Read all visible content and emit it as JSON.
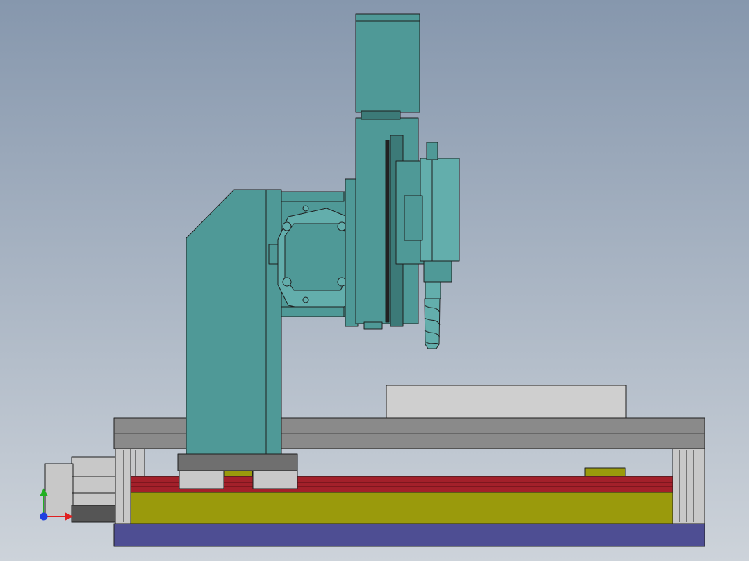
{
  "viewport": {
    "background_top": "#8697ad",
    "background_bottom": "#cdd3da"
  },
  "model": {
    "colors": {
      "teal": "#4f9997",
      "teal_light": "#63aeac",
      "teal_dark": "#3c7a78",
      "frame_gray": "#8a8a8a",
      "frame_gray_dark": "#6f6f6f",
      "light_gray": "#c8c8c8",
      "red_rail": "#a3202a",
      "olive": "#9a9a0c",
      "base_blue": "#4e4e93",
      "stock": "#cfcfcf",
      "outline": "#1e1e1e"
    },
    "parts": [
      "column",
      "tilt-head",
      "z-axis-slide",
      "spindle-motor",
      "spindle-housing",
      "end-mill",
      "workpiece",
      "table",
      "column-base",
      "y-carriage",
      "red-guide-rail",
      "olive-bed",
      "base-plate",
      "drive-motor",
      "side-bracket"
    ]
  },
  "triad": {
    "x_color": "#e02020",
    "y_color": "#20b020",
    "z_color": "#2040e0"
  }
}
